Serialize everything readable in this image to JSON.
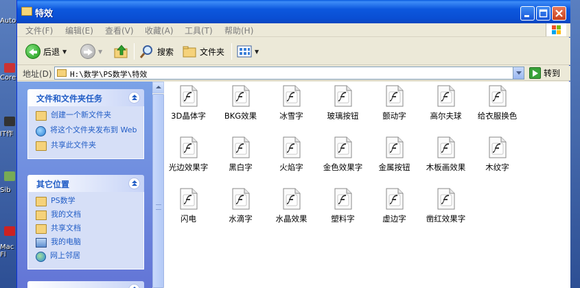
{
  "desktop": {
    "labels": [
      "Auto",
      "Core",
      "IT作",
      "Sib",
      "Mac Fl"
    ]
  },
  "window": {
    "title": "特效",
    "colors": {
      "titlebar": "#0a4ed3",
      "task_link": "#215dc6",
      "pane_bg": "#7ba2e7"
    }
  },
  "menu": {
    "items": [
      "文件(F)",
      "编辑(E)",
      "查看(V)",
      "收藏(A)",
      "工具(T)",
      "帮助(H)"
    ]
  },
  "toolbar": {
    "back_label": "后退",
    "search_label": "搜索",
    "folders_label": "文件夹",
    "icons": {
      "back": "back-arrow-icon",
      "forward": "forward-arrow-icon",
      "up": "folder-up-icon",
      "search": "magnifier-icon",
      "folders": "folders-icon",
      "views": "views-icon"
    }
  },
  "address": {
    "label": "地址(D)",
    "path": "H:\\数学\\PS数学\\特效",
    "go_label": "转到"
  },
  "tasks_panel": {
    "title": "文件和文件夹任务",
    "items": [
      {
        "label": "创建一个新文件夹",
        "icon": "new-folder-icon"
      },
      {
        "label": "将这个文件夹发布到 Web",
        "icon": "publish-web-icon"
      },
      {
        "label": "共享此文件夹",
        "icon": "share-folder-icon"
      }
    ]
  },
  "places_panel": {
    "title": "其它位置",
    "items": [
      {
        "label": "PS数学",
        "icon": "folder-icon"
      },
      {
        "label": "我的文档",
        "icon": "my-documents-icon"
      },
      {
        "label": "共享文档",
        "icon": "shared-documents-icon"
      },
      {
        "label": "我的电脑",
        "icon": "my-computer-icon"
      },
      {
        "label": "网上邻居",
        "icon": "network-places-icon"
      }
    ]
  },
  "files": [
    "3D晶体字",
    "BKG效果",
    "冰雪字",
    "玻璃按钮",
    "颤动字",
    "高尔夫球",
    "给衣服换色",
    "光边效果字",
    "黑白字",
    "火焰字",
    "金色效果字",
    "金属按钮",
    "木板画效果",
    "木纹字",
    "闪电",
    "水滴字",
    "水晶效果",
    "塑料字",
    "虚边字",
    "凿红效果字"
  ]
}
